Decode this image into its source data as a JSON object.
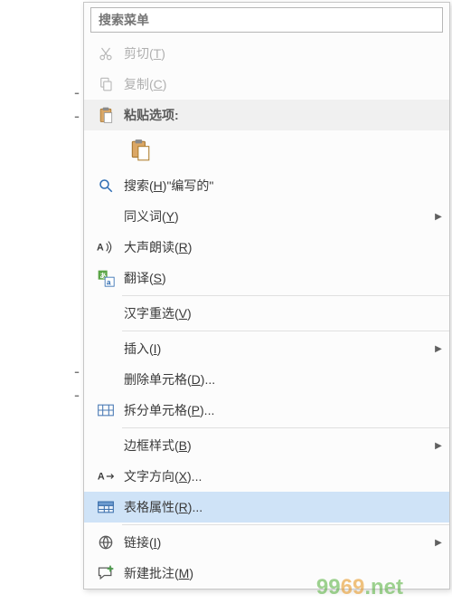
{
  "search": {
    "placeholder": "搜索菜单"
  },
  "items": {
    "cut": {
      "pre": "剪切(",
      "key": "T",
      "post": ")"
    },
    "copy": {
      "pre": "复制(",
      "key": "C",
      "post": ")"
    },
    "pasteHeader": {
      "text": "粘贴选项:"
    },
    "search_written": {
      "pre": "搜索(",
      "key": "H",
      "post": ")\"编写的\""
    },
    "synonyms": {
      "pre": "同义词(",
      "key": "Y",
      "post": ")"
    },
    "read_aloud": {
      "pre": "大声朗读(",
      "key": "R",
      "post": ")"
    },
    "translate": {
      "pre": "翻译(",
      "key": "S",
      "post": ")"
    },
    "reconvert": {
      "pre": "汉字重选(",
      "key": "V",
      "post": ")"
    },
    "insert": {
      "pre": "插入(",
      "key": "I",
      "post": ")"
    },
    "delete_cells": {
      "pre": "删除单元格(",
      "key": "D",
      "post": ")..."
    },
    "split_cells": {
      "pre": "拆分单元格(",
      "key": "P",
      "post": ")..."
    },
    "border_styles": {
      "pre": "边框样式(",
      "key": "B",
      "post": ")"
    },
    "text_direction": {
      "pre": "文字方向(",
      "key": "X",
      "post": ")..."
    },
    "table_props": {
      "pre": "表格属性(",
      "key": "R",
      "post": ")..."
    },
    "link": {
      "pre": "链接(",
      "key": "I",
      "post": ")"
    },
    "new_comment": {
      "pre": "新建批注(",
      "key": "M",
      "post": ")"
    }
  },
  "watermark": {
    "text": "9969.net"
  }
}
